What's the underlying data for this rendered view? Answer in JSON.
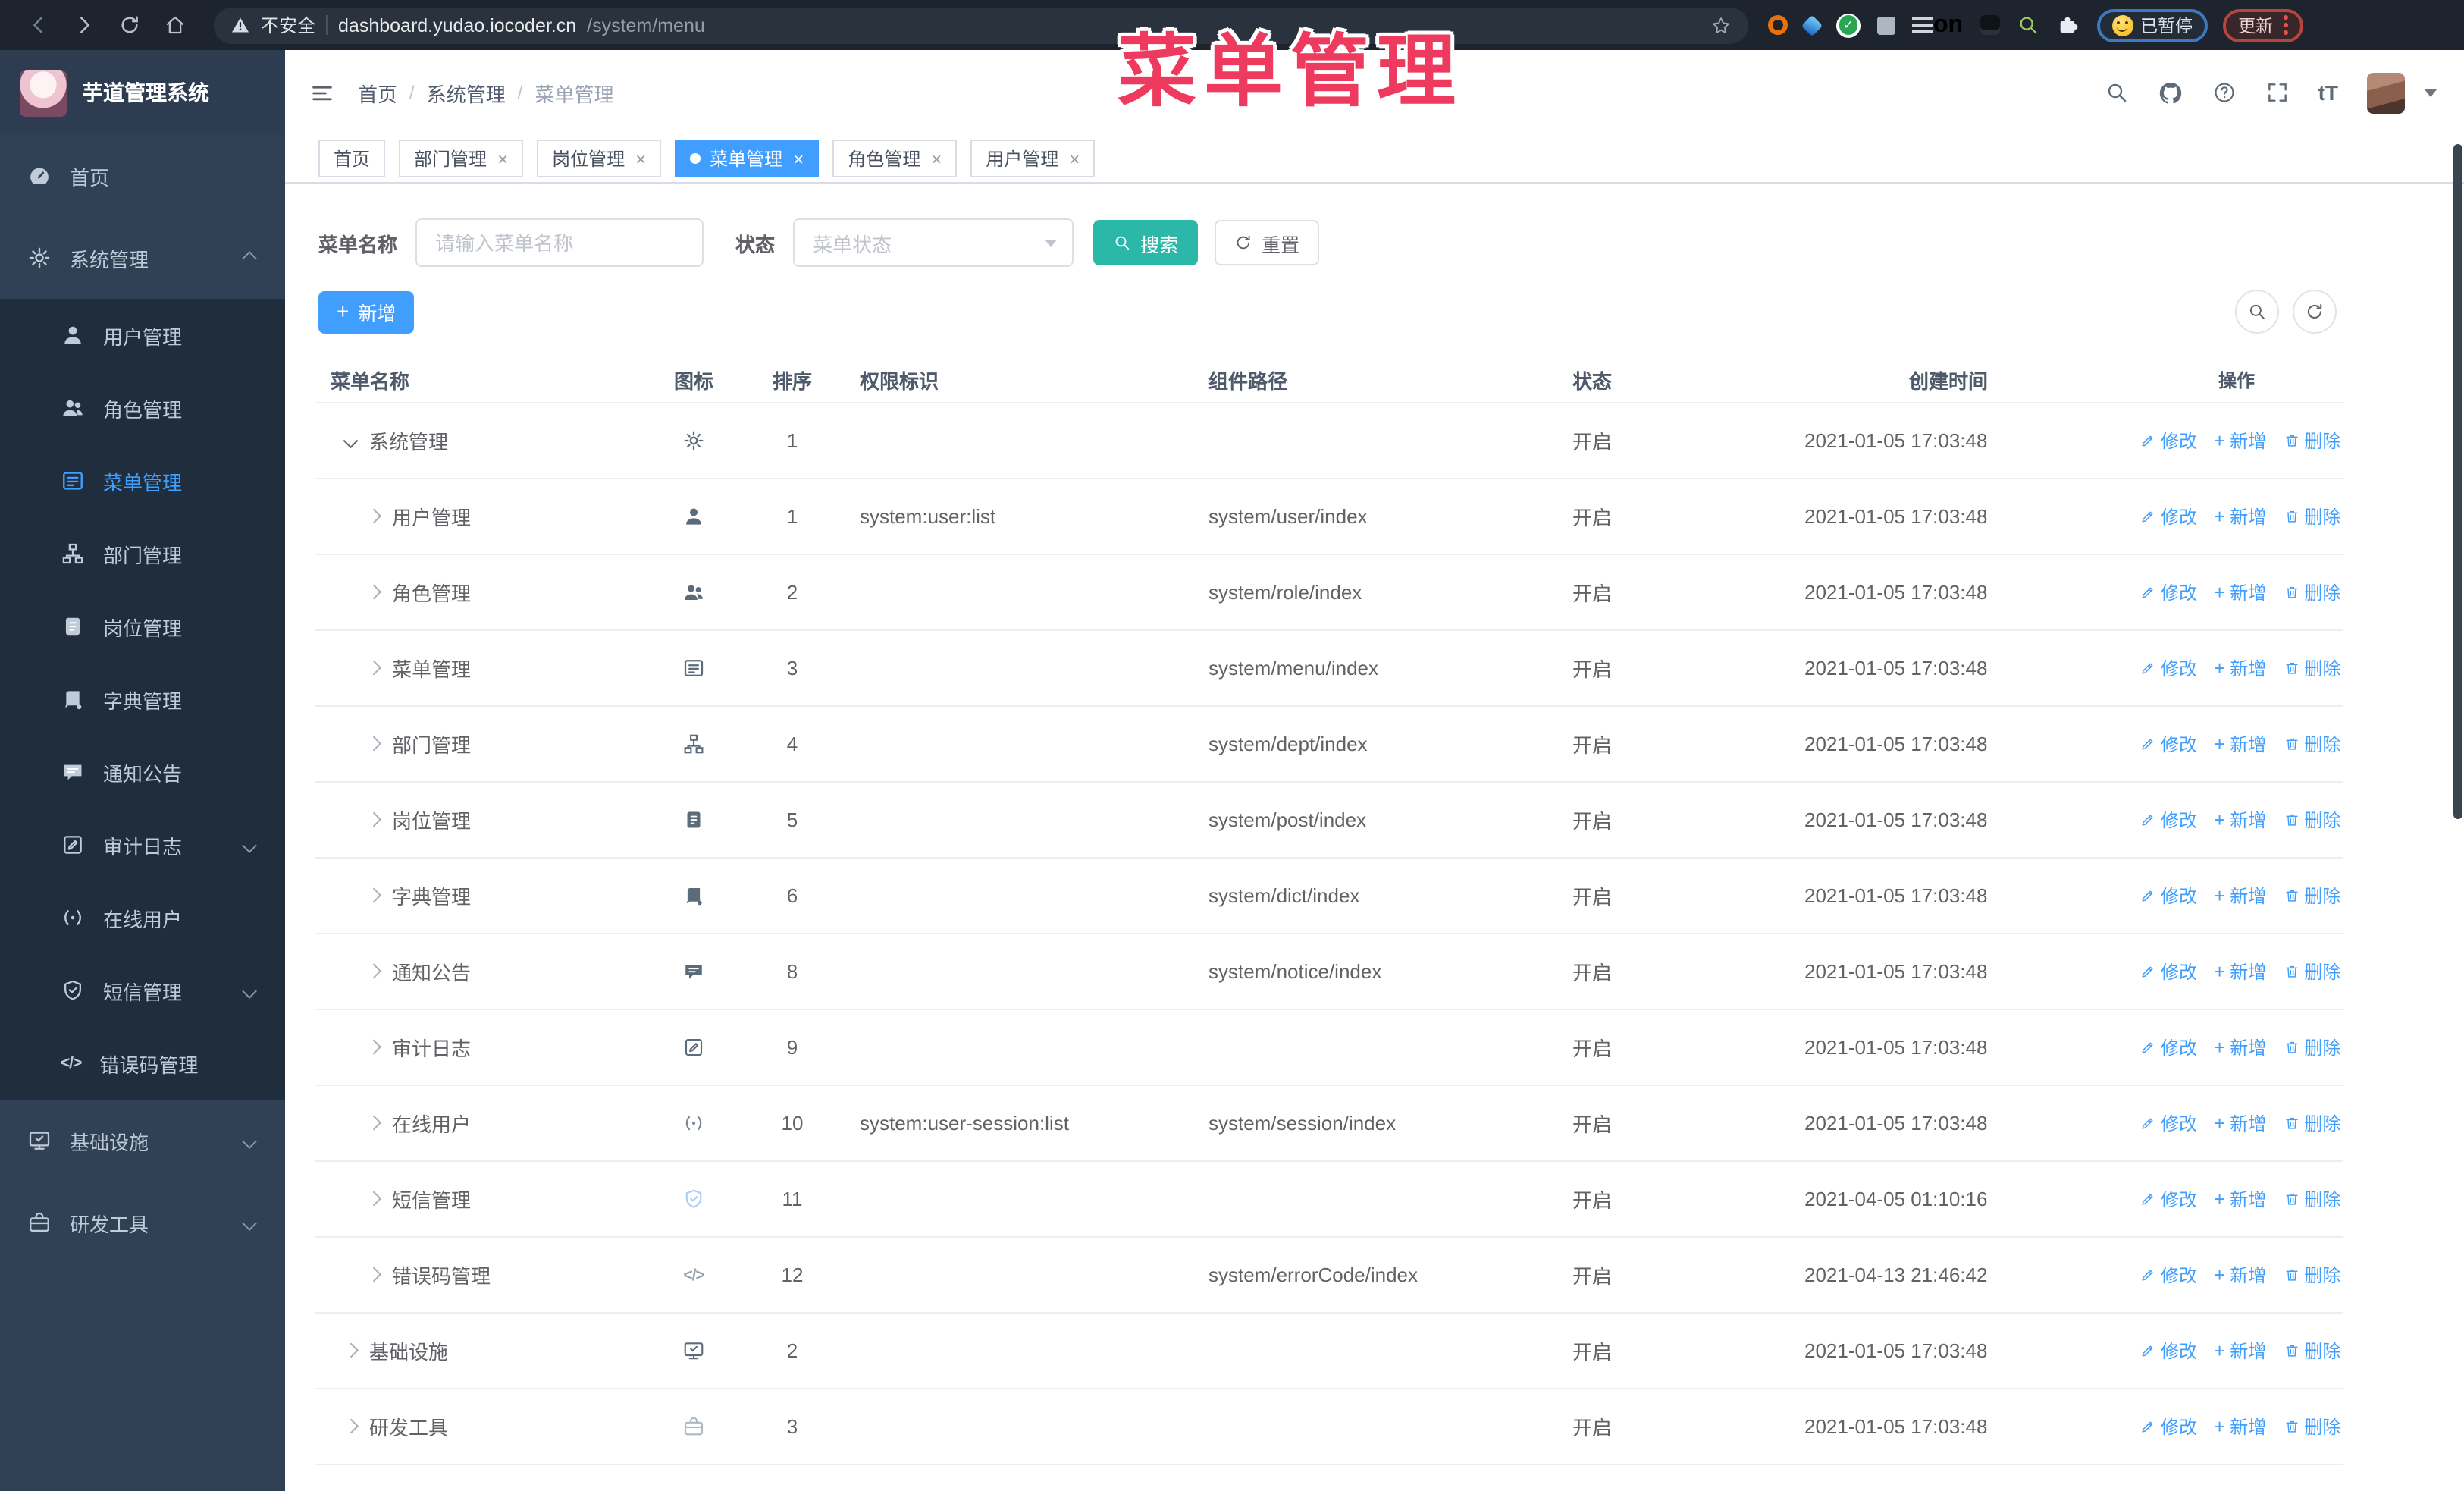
{
  "browser": {
    "security_label": "不安全",
    "url_host": "dashboard.yudao.iocoder.cn",
    "url_path": "/system/menu",
    "extension_on_label": "on",
    "paused_label": "已暂停",
    "update_label": "更新"
  },
  "overlay_title": "菜单管理",
  "sidebar": {
    "logo_text": "芋道管理系统",
    "items": [
      {
        "label": "首页",
        "icon": "gauge",
        "level": 0
      },
      {
        "label": "系统管理",
        "icon": "gear",
        "level": 0,
        "chevron": "up"
      },
      {
        "label": "用户管理",
        "icon": "user",
        "level": 1
      },
      {
        "label": "角色管理",
        "icon": "users",
        "level": 1
      },
      {
        "label": "菜单管理",
        "icon": "menu",
        "level": 1,
        "active": true
      },
      {
        "label": "部门管理",
        "icon": "tree",
        "level": 1
      },
      {
        "label": "岗位管理",
        "icon": "badge",
        "level": 1
      },
      {
        "label": "字典管理",
        "icon": "book",
        "level": 1
      },
      {
        "label": "通知公告",
        "icon": "bubble",
        "level": 1
      },
      {
        "label": "审计日志",
        "icon": "note",
        "level": 1,
        "chevron": "down"
      },
      {
        "label": "在线用户",
        "icon": "link",
        "level": 1
      },
      {
        "label": "短信管理",
        "icon": "shield",
        "level": 1,
        "chevron": "down"
      },
      {
        "label": "错误码管理",
        "icon": "code",
        "level": 1
      },
      {
        "label": "基础设施",
        "icon": "monitor",
        "level": 0,
        "chevron": "down"
      },
      {
        "label": "研发工具",
        "icon": "briefcase",
        "level": 0,
        "chevron": "down"
      }
    ]
  },
  "header": {
    "breadcrumb": [
      "首页",
      "系统管理",
      "菜单管理"
    ],
    "font_size_label": "tT"
  },
  "tabs": [
    {
      "label": "首页",
      "closable": false
    },
    {
      "label": "部门管理",
      "closable": true
    },
    {
      "label": "岗位管理",
      "closable": true
    },
    {
      "label": "菜单管理",
      "closable": true,
      "active": true
    },
    {
      "label": "角色管理",
      "closable": true
    },
    {
      "label": "用户管理",
      "closable": true
    }
  ],
  "filters": {
    "name_label": "菜单名称",
    "name_placeholder": "请输入菜单名称",
    "status_label": "状态",
    "status_placeholder": "菜单状态",
    "search_label": "搜索",
    "reset_label": "重置"
  },
  "toolbar": {
    "add_label": "新增"
  },
  "table": {
    "columns": [
      "菜单名称",
      "图标",
      "排序",
      "权限标识",
      "组件路径",
      "状态",
      "创建时间",
      "操作"
    ],
    "row_actions": {
      "edit": "修改",
      "add": "新增",
      "delete": "删除"
    },
    "rows": [
      {
        "name": "系统管理",
        "icon": "gear",
        "sort": "1",
        "perm": "",
        "path": "",
        "status": "开启",
        "created": "2021-01-05 17:03:48",
        "level": 0,
        "expanded": true
      },
      {
        "name": "用户管理",
        "icon": "user",
        "sort": "1",
        "perm": "system:user:list",
        "path": "system/user/index",
        "status": "开启",
        "created": "2021-01-05 17:03:48",
        "level": 1
      },
      {
        "name": "角色管理",
        "icon": "users",
        "sort": "2",
        "perm": "",
        "path": "system/role/index",
        "status": "开启",
        "created": "2021-01-05 17:03:48",
        "level": 1
      },
      {
        "name": "菜单管理",
        "icon": "menu",
        "sort": "3",
        "perm": "",
        "path": "system/menu/index",
        "status": "开启",
        "created": "2021-01-05 17:03:48",
        "level": 1
      },
      {
        "name": "部门管理",
        "icon": "tree",
        "sort": "4",
        "perm": "",
        "path": "system/dept/index",
        "status": "开启",
        "created": "2021-01-05 17:03:48",
        "level": 1
      },
      {
        "name": "岗位管理",
        "icon": "badge",
        "sort": "5",
        "perm": "",
        "path": "system/post/index",
        "status": "开启",
        "created": "2021-01-05 17:03:48",
        "level": 1
      },
      {
        "name": "字典管理",
        "icon": "book",
        "sort": "6",
        "perm": "",
        "path": "system/dict/index",
        "status": "开启",
        "created": "2021-01-05 17:03:48",
        "level": 1
      },
      {
        "name": "通知公告",
        "icon": "bubble",
        "sort": "8",
        "perm": "",
        "path": "system/notice/index",
        "status": "开启",
        "created": "2021-01-05 17:03:48",
        "level": 1
      },
      {
        "name": "审计日志",
        "icon": "note",
        "sort": "9",
        "perm": "",
        "path": "",
        "status": "开启",
        "created": "2021-01-05 17:03:48",
        "level": 1
      },
      {
        "name": "在线用户",
        "icon": "link",
        "sort": "10",
        "perm": "system:user-session:list",
        "path": "system/session/index",
        "status": "开启",
        "created": "2021-01-05 17:03:48",
        "level": 1,
        "icon_color": "#7d8a99"
      },
      {
        "name": "短信管理",
        "icon": "shield",
        "sort": "11",
        "perm": "",
        "path": "",
        "status": "开启",
        "created": "2021-04-05 01:10:16",
        "level": 1,
        "icon_color": "#a9cdf8"
      },
      {
        "name": "错误码管理",
        "icon": "code",
        "sort": "12",
        "perm": "",
        "path": "system/errorCode/index",
        "status": "开启",
        "created": "2021-04-13 21:46:42",
        "level": 1,
        "icon_color": "#98a2b0"
      },
      {
        "name": "基础设施",
        "icon": "monitor",
        "sort": "2",
        "perm": "",
        "path": "",
        "status": "开启",
        "created": "2021-01-05 17:03:48",
        "level": 0
      },
      {
        "name": "研发工具",
        "icon": "briefcase",
        "sort": "3",
        "perm": "",
        "path": "",
        "status": "开启",
        "created": "2021-01-05 17:03:48",
        "level": 0,
        "icon_color": "#aeb8c4"
      }
    ]
  },
  "colors": {
    "accent_blue": "#409eff",
    "search_teal": "#2bb8a8",
    "sidebar_bg": "#304156",
    "sidebar_submenu_bg": "#1f2d3d",
    "overlay_red": "#ee3a5f",
    "table_border": "#ebeef5"
  }
}
